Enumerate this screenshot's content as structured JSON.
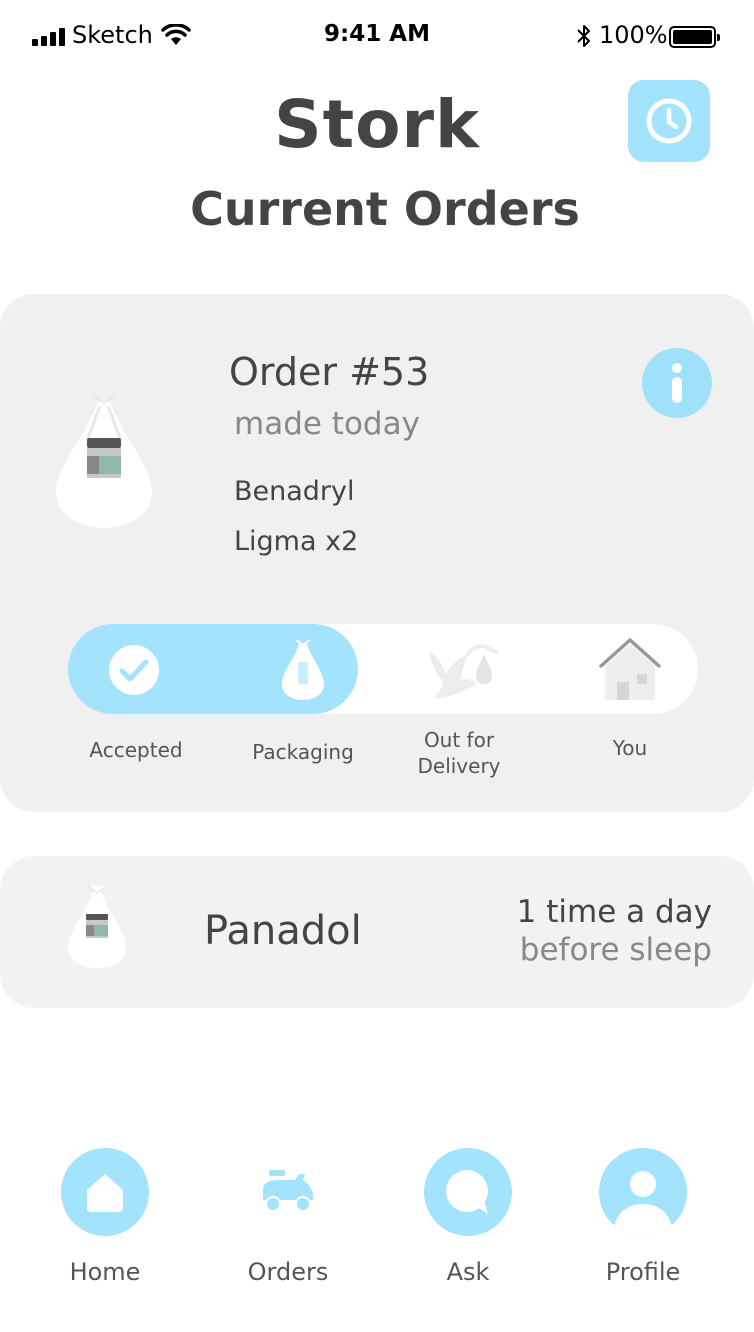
{
  "status_bar": {
    "carrier": "Sketch",
    "time": "9:41 AM",
    "battery": "100%"
  },
  "header": {
    "app_title": "Stork",
    "page_title": "Current Orders",
    "history_icon": "clock-icon"
  },
  "order": {
    "title": "Order #53",
    "subtitle": "made today",
    "items": [
      "Benadryl",
      "Ligma x2"
    ],
    "info_icon": "info-icon",
    "progress_fraction": 0.46,
    "steps": [
      {
        "label": "Accepted",
        "icon": "check-icon",
        "done": true
      },
      {
        "label": "Packaging",
        "icon": "bag-icon",
        "done": true
      },
      {
        "label": "Out for\nDelivery",
        "icon": "stork-icon",
        "done": false
      },
      {
        "label": "You",
        "icon": "house-icon",
        "done": false
      }
    ]
  },
  "medication": {
    "name": "Panadol",
    "frequency": "1 time a day",
    "timing": "before sleep"
  },
  "nav": {
    "items": [
      {
        "label": "Home",
        "icon": "home-icon"
      },
      {
        "label": "Orders",
        "icon": "scooter-icon"
      },
      {
        "label": "Ask",
        "icon": "chat-icon"
      },
      {
        "label": "Profile",
        "icon": "user-icon"
      }
    ]
  },
  "colors": {
    "accent": "#a3e3fb",
    "card": "#f0f0f0",
    "text": "#444444",
    "muted": "#888888"
  }
}
